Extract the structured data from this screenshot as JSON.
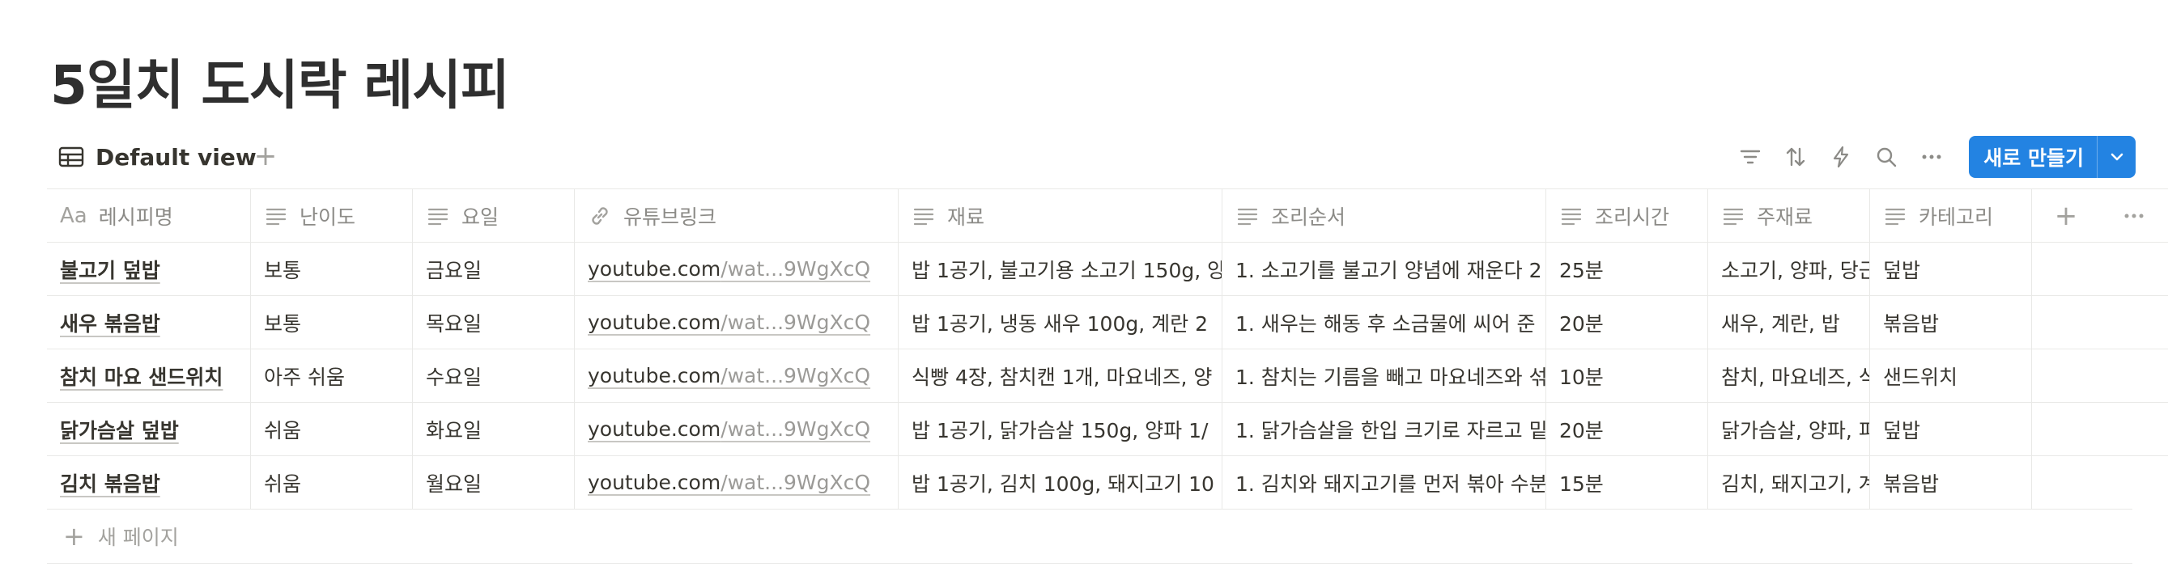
{
  "page": {
    "title": "5일치 도시락 레시피"
  },
  "view": {
    "tab_label": "Default view",
    "new_button_label": "새로 만들기",
    "accent_color": "#2383e2"
  },
  "table": {
    "columns": [
      {
        "label": "레시피명",
        "icon": "title-aa-icon"
      },
      {
        "label": "난이도",
        "icon": "text-lines-icon"
      },
      {
        "label": "요일",
        "icon": "text-lines-icon"
      },
      {
        "label": "유튜브링크",
        "icon": "link-icon"
      },
      {
        "label": "재료",
        "icon": "text-lines-icon"
      },
      {
        "label": "조리순서",
        "icon": "text-lines-icon"
      },
      {
        "label": "조리시간",
        "icon": "text-lines-icon"
      },
      {
        "label": "주재료",
        "icon": "text-lines-icon"
      },
      {
        "label": "카테고리",
        "icon": "text-lines-icon"
      }
    ],
    "rows": [
      {
        "name": "불고기 덮밥",
        "difficulty": "보통",
        "day": "금요일",
        "link_host": "youtube.com",
        "link_rest": "/wat...9WgXcQ",
        "ingredients": "밥 1공기, 불고기용 소고기 150g, 양",
        "steps": "1. 소고기를 불고기 양념에 재운다 2",
        "time": "25분",
        "main": "소고기, 양파, 당근",
        "category": "덮밥"
      },
      {
        "name": "새우 볶음밥",
        "difficulty": "보통",
        "day": "목요일",
        "link_host": "youtube.com",
        "link_rest": "/wat...9WgXcQ",
        "ingredients": "밥 1공기, 냉동 새우 100g, 계란 2",
        "steps": "1. 새우는 해동 후 소금물에 씨어 준",
        "time": "20분",
        "main": "새우, 계란, 밥",
        "category": "볶음밥"
      },
      {
        "name": "참치 마요 샌드위치",
        "difficulty": "아주 쉬움",
        "day": "수요일",
        "link_host": "youtube.com",
        "link_rest": "/wat...9WgXcQ",
        "ingredients": "식빵 4장, 참치캔 1개, 마요네즈, 양",
        "steps": "1. 참치는 기름을 빼고 마요네즈와 섞",
        "time": "10분",
        "main": "참치, 마요네즈, 식빵",
        "category": "샌드위치"
      },
      {
        "name": "닭가슴살 덮밥",
        "difficulty": "쉬움",
        "day": "화요일",
        "link_host": "youtube.com",
        "link_rest": "/wat...9WgXcQ",
        "ingredients": "밥 1공기, 닭가슴살 150g, 양파 1/",
        "steps": "1. 닭가슴살을 한입 크기로 자르고 밑",
        "time": "20분",
        "main": "닭가슴살, 양파, 피망",
        "category": "덮밥"
      },
      {
        "name": "김치 볶음밥",
        "difficulty": "쉬움",
        "day": "월요일",
        "link_host": "youtube.com",
        "link_rest": "/wat...9WgXcQ",
        "ingredients": "밥 1공기, 김치 100g, 돼지고기 10",
        "steps": "1. 김치와 돼지고기를 먼저 볶아 수분",
        "time": "15분",
        "main": "김치, 돼지고기, 계란",
        "category": "볶음밥"
      }
    ],
    "new_page_label": "새 페이지"
  }
}
